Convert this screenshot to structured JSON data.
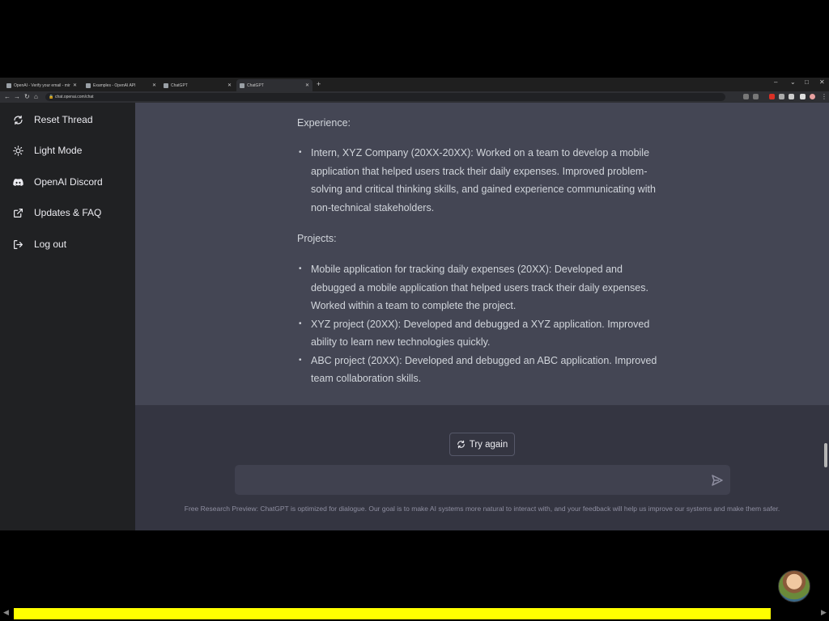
{
  "browser": {
    "tabs": [
      {
        "label": "OpenAI - Verify your email - miri",
        "active": false
      },
      {
        "label": "Examples - OpenAI API",
        "active": false
      },
      {
        "label": "ChatGPT",
        "active": false
      },
      {
        "label": "ChatGPT",
        "active": true
      }
    ],
    "new_tab_icon": "plus-icon",
    "address": "chat.openai.com/chat",
    "window_controls": {
      "minimize": "–",
      "restore": "□",
      "close": "✕"
    }
  },
  "sidebar": {
    "items": [
      {
        "label": "Reset Thread",
        "icon": "reset-icon"
      },
      {
        "label": "Light Mode",
        "icon": "sun-icon"
      },
      {
        "label": "OpenAI Discord",
        "icon": "discord-icon"
      },
      {
        "label": "Updates & FAQ",
        "icon": "external-link-icon"
      },
      {
        "label": "Log out",
        "icon": "logout-icon"
      }
    ]
  },
  "message": {
    "experience_heading": "Experience:",
    "experience_items": [
      "Intern, XYZ Company (20XX-20XX): Worked on a team to develop a mobile application that helped users track their daily expenses. Improved problem-solving and critical thinking skills, and gained experience communicating with non-technical stakeholders."
    ],
    "projects_heading": "Projects:",
    "project_items": [
      "Mobile application for tracking daily expenses (20XX): Developed and debugged a mobile application that helped users track their daily expenses. Worked within a team to complete the project.",
      "XYZ project (20XX): Developed and debugged a XYZ application. Improved ability to learn new technologies quickly.",
      "ABC project (20XX): Developed and debugged an ABC application. Improved team collaboration skills."
    ]
  },
  "controls": {
    "try_again_label": "Try again",
    "input_value": "",
    "send_icon": "send-icon"
  },
  "footer": {
    "text": "Free Research Preview: ChatGPT is optimized for dialogue. Our goal is to make AI systems more natural to interact with, and your feedback will help us improve our systems and make them safer."
  },
  "video_overlay": {
    "progress": 0.94,
    "progress_color": "#ffff00"
  },
  "colors": {
    "sidebar_bg": "#202123",
    "message_bg": "#444654",
    "main_bg": "#343541",
    "input_bg": "#40414f"
  }
}
